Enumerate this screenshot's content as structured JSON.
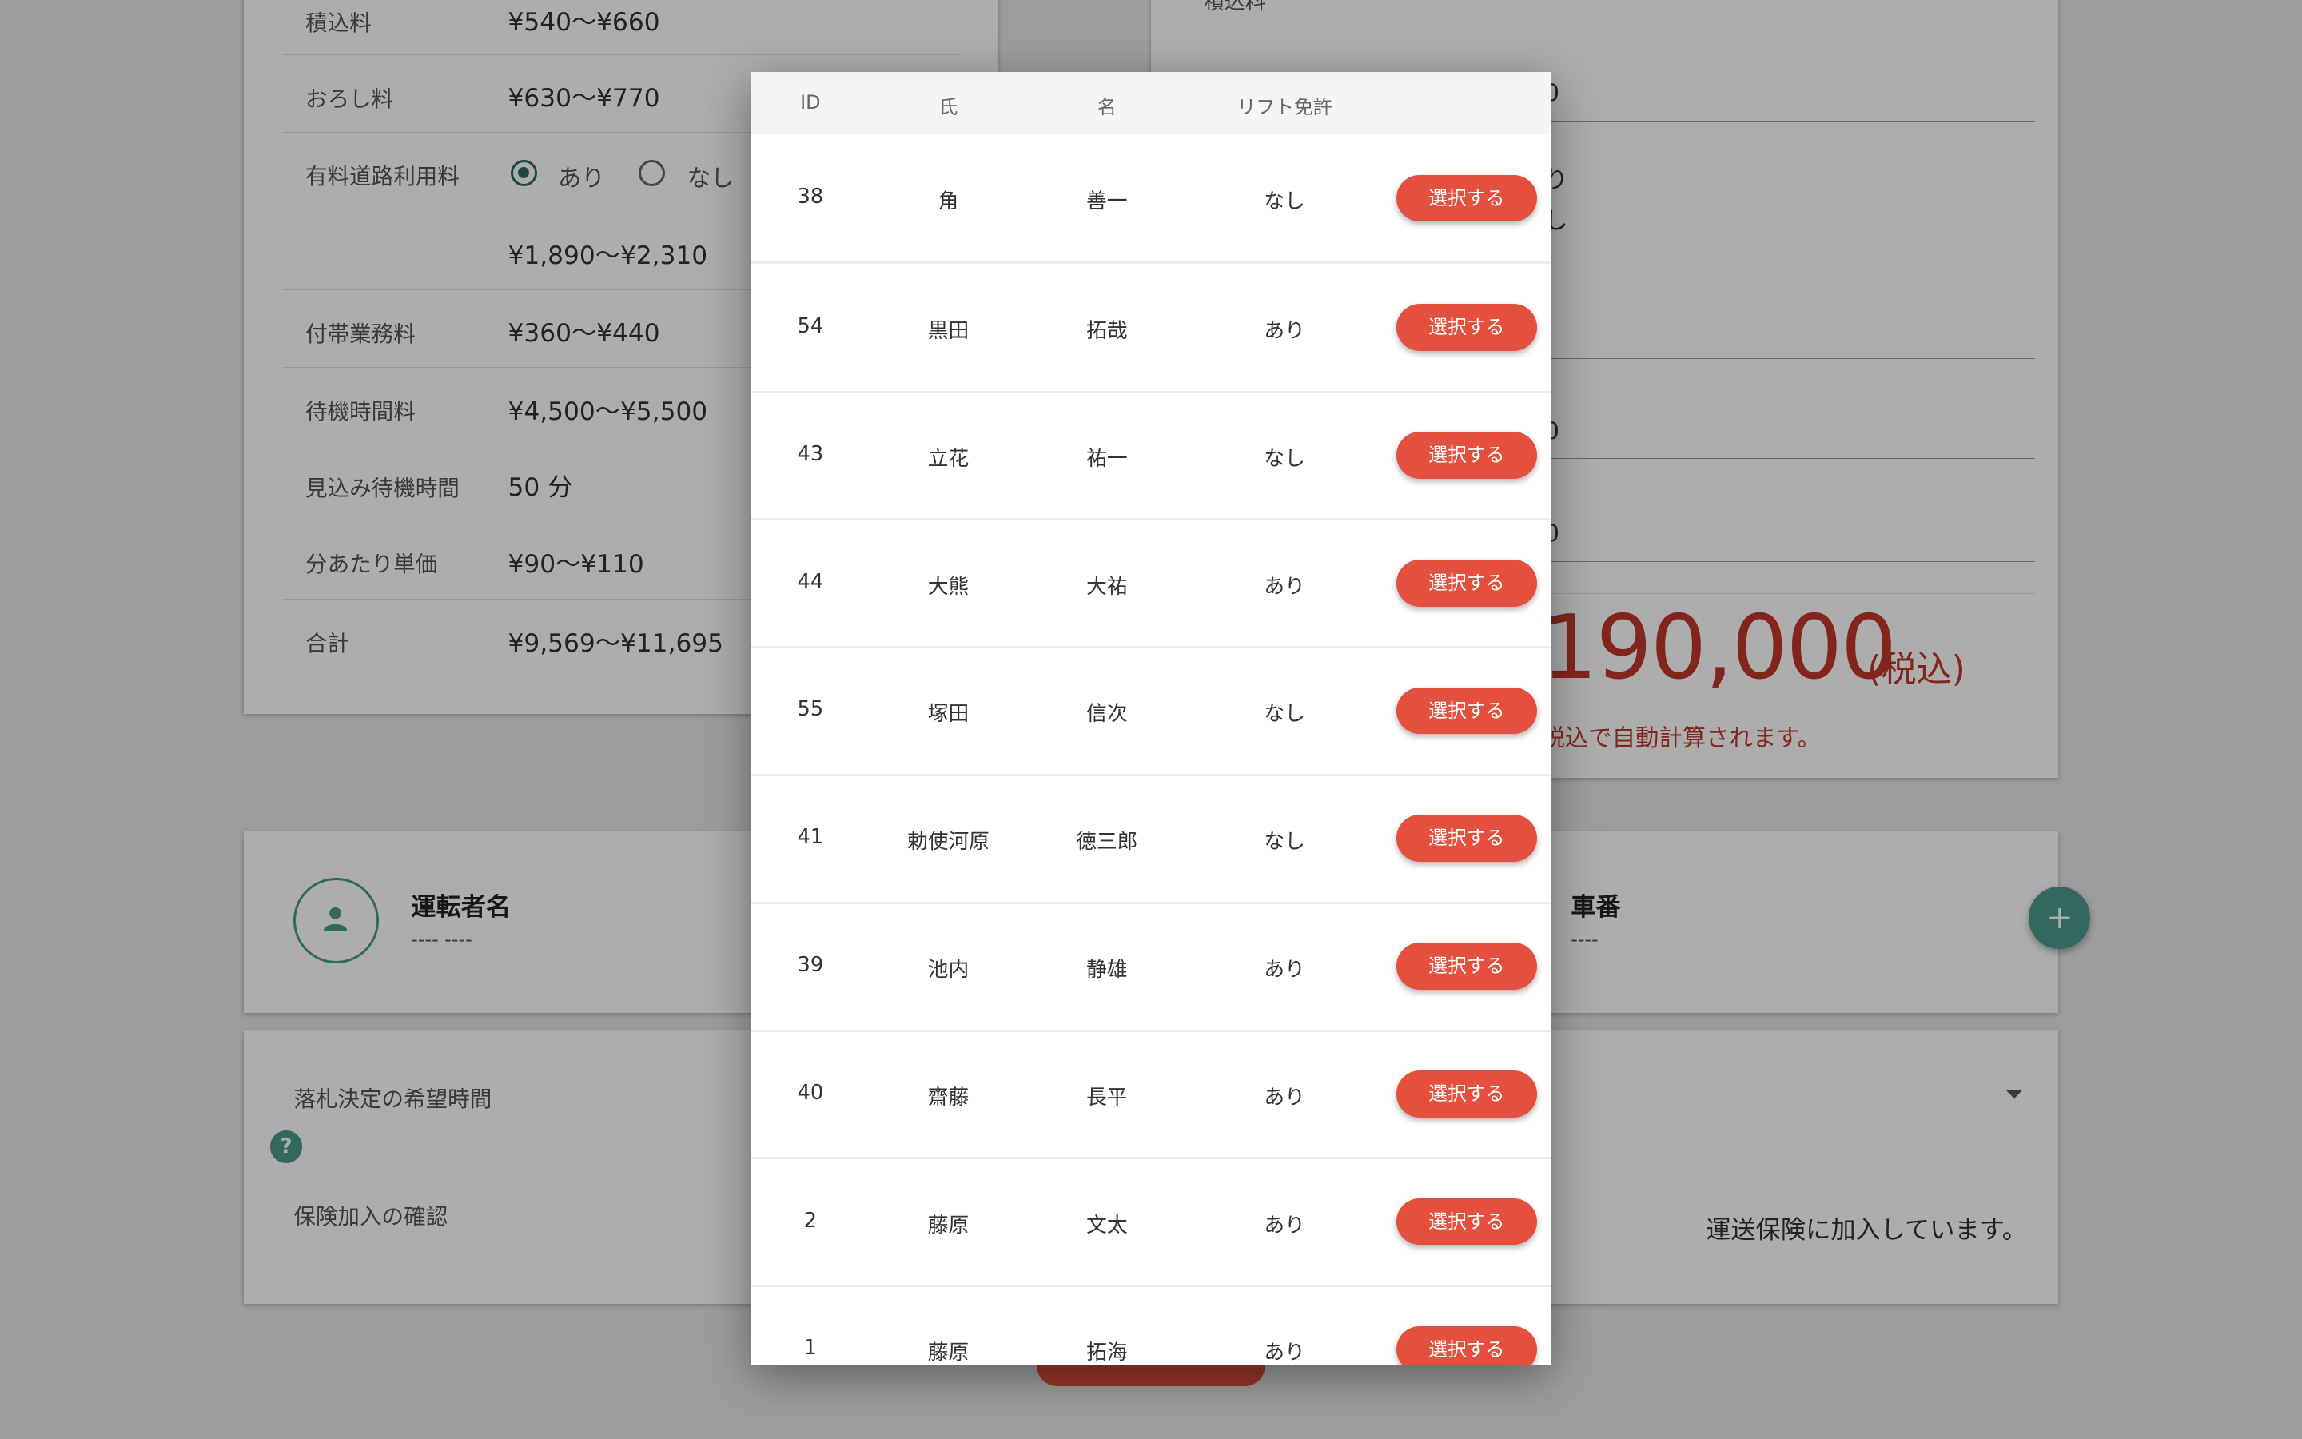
{
  "fee_table": {
    "rows": [
      {
        "label": "積込料",
        "value": "¥540〜¥660"
      },
      {
        "label": "おろし料",
        "value": "¥630〜¥770"
      },
      {
        "label": "有料道路利用料",
        "value": "¥1,890〜¥2,310"
      },
      {
        "label": "付帯業務料",
        "value": "¥360〜¥440"
      },
      {
        "label": "待機時間料",
        "value": "¥4,500〜¥5,500"
      },
      {
        "label": "見込み待機時間",
        "value": "50 分"
      },
      {
        "label": "分あたり単価",
        "value": "¥90〜¥110"
      },
      {
        "label": "合計",
        "value": "¥9,569〜¥11,695"
      }
    ],
    "toll_options": {
      "yes": "あり",
      "no": "なし",
      "selected": "あり"
    }
  },
  "price_form": {
    "loading_label": "積込料",
    "partial_options": {
      "yes": "り",
      "no": "し"
    },
    "partial_values": [
      "0",
      "0",
      "0"
    ],
    "total": "190,000",
    "total_tax": "(税込)",
    "total_note": "税込で自動計算されます。"
  },
  "driver": {
    "title": "運転者名",
    "name": "---- ----",
    "car_title": "車番",
    "car_no": "----",
    "add_icon": "+"
  },
  "bid": {
    "desired_time_label": "落札決定の希望時間",
    "help_icon": "?",
    "insurance_label": "保険加入の確認",
    "insurance_text": "運送保険に加入しています。"
  },
  "dialog": {
    "headers": {
      "id": "ID",
      "last": "氏",
      "first": "名",
      "license": "リフト免許"
    },
    "select_label": "選択する",
    "rows": [
      {
        "id": "38",
        "last": "角",
        "first": "善一",
        "license": "なし"
      },
      {
        "id": "54",
        "last": "黒田",
        "first": "拓哉",
        "license": "あり"
      },
      {
        "id": "43",
        "last": "立花",
        "first": "祐一",
        "license": "なし"
      },
      {
        "id": "44",
        "last": "大熊",
        "first": "大祐",
        "license": "あり"
      },
      {
        "id": "55",
        "last": "塚田",
        "first": "信次",
        "license": "なし"
      },
      {
        "id": "41",
        "last": "勅使河原",
        "first": "徳三郎",
        "license": "なし"
      },
      {
        "id": "39",
        "last": "池内",
        "first": "静雄",
        "license": "あり"
      },
      {
        "id": "40",
        "last": "齋藤",
        "first": "長平",
        "license": "あり"
      },
      {
        "id": "2",
        "last": "藤原",
        "first": "文太",
        "license": "あり"
      },
      {
        "id": "1",
        "last": "藤原",
        "first": "拓海",
        "license": "あり"
      }
    ]
  }
}
